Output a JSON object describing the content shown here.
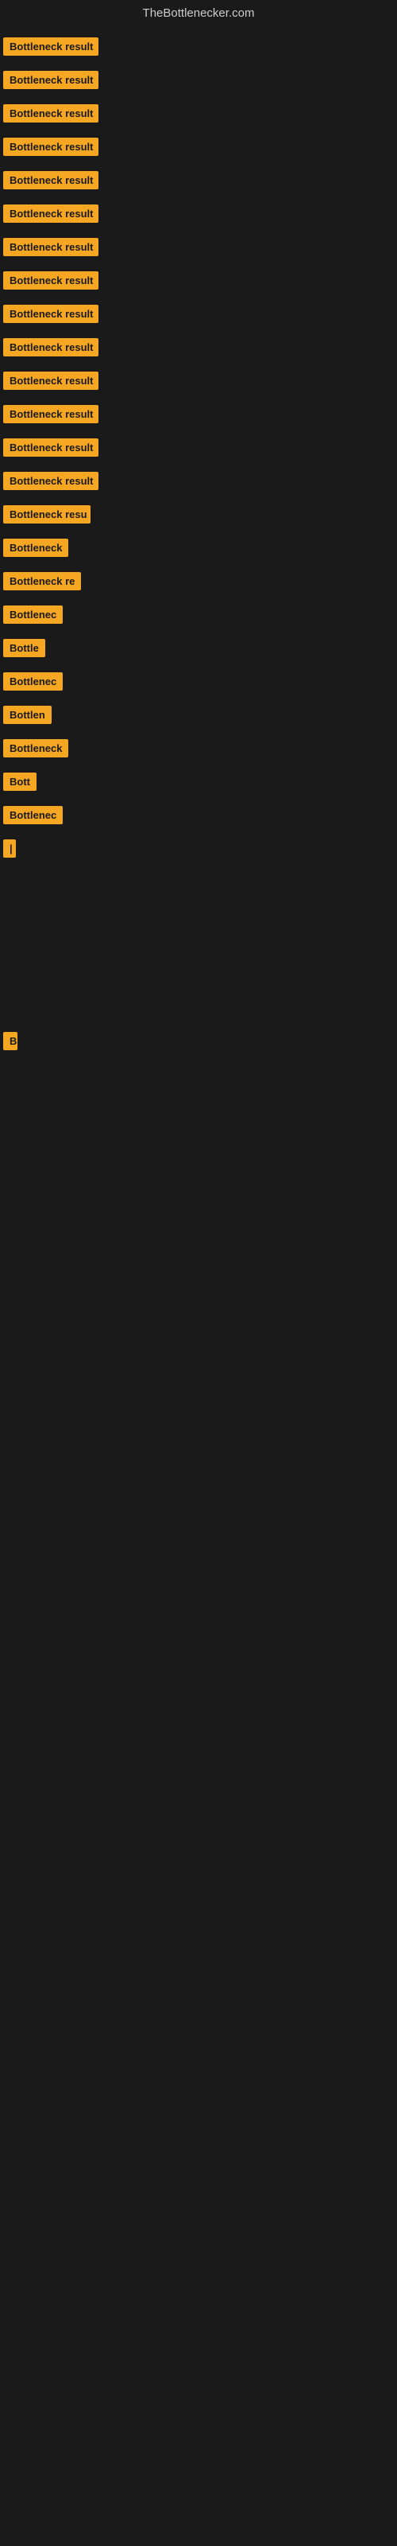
{
  "header": {
    "site_name": "TheBottlenecker.com"
  },
  "items": [
    {
      "id": 0,
      "label": "Bottleneck result",
      "visible_text": "Bottleneck result"
    },
    {
      "id": 1,
      "label": "Bottleneck result",
      "visible_text": "Bottleneck result"
    },
    {
      "id": 2,
      "label": "Bottleneck result",
      "visible_text": "Bottleneck result"
    },
    {
      "id": 3,
      "label": "Bottleneck result",
      "visible_text": "Bottleneck result"
    },
    {
      "id": 4,
      "label": "Bottleneck result",
      "visible_text": "Bottleneck result"
    },
    {
      "id": 5,
      "label": "Bottleneck result",
      "visible_text": "Bottleneck result"
    },
    {
      "id": 6,
      "label": "Bottleneck result",
      "visible_text": "Bottleneck result"
    },
    {
      "id": 7,
      "label": "Bottleneck result",
      "visible_text": "Bottleneck result"
    },
    {
      "id": 8,
      "label": "Bottleneck result",
      "visible_text": "Bottleneck result"
    },
    {
      "id": 9,
      "label": "Bottleneck result",
      "visible_text": "Bottleneck result"
    },
    {
      "id": 10,
      "label": "Bottleneck result",
      "visible_text": "Bottleneck result"
    },
    {
      "id": 11,
      "label": "Bottleneck result",
      "visible_text": "Bottleneck result"
    },
    {
      "id": 12,
      "label": "Bottleneck result",
      "visible_text": "Bottleneck result"
    },
    {
      "id": 13,
      "label": "Bottleneck result",
      "visible_text": "Bottleneck result"
    },
    {
      "id": 14,
      "label": "Bottleneck result",
      "visible_text": "Bottleneck resu"
    },
    {
      "id": 15,
      "label": "Bottleneck",
      "visible_text": "Bottleneck"
    },
    {
      "id": 16,
      "label": "Bottleneck re",
      "visible_text": "Bottleneck re"
    },
    {
      "id": 17,
      "label": "Bottlenec",
      "visible_text": "Bottlenec"
    },
    {
      "id": 18,
      "label": "Bottle",
      "visible_text": "Bottle"
    },
    {
      "id": 19,
      "label": "Bottlenec",
      "visible_text": "Bottlenec"
    },
    {
      "id": 20,
      "label": "Bottlen",
      "visible_text": "Bottlen"
    },
    {
      "id": 21,
      "label": "Bottleneck",
      "visible_text": "Bottleneck"
    },
    {
      "id": 22,
      "label": "Bott",
      "visible_text": "Bott"
    },
    {
      "id": 23,
      "label": "Bottlenec",
      "visible_text": "Bottlenec"
    },
    {
      "id": 24,
      "label": "|",
      "visible_text": "|"
    }
  ],
  "bottom_item": {
    "label": "B",
    "visible_text": "B"
  },
  "colors": {
    "background": "#1a1a1a",
    "badge_bg": "#f5a623",
    "badge_text": "#1a1a1a",
    "header_text": "#cccccc"
  }
}
